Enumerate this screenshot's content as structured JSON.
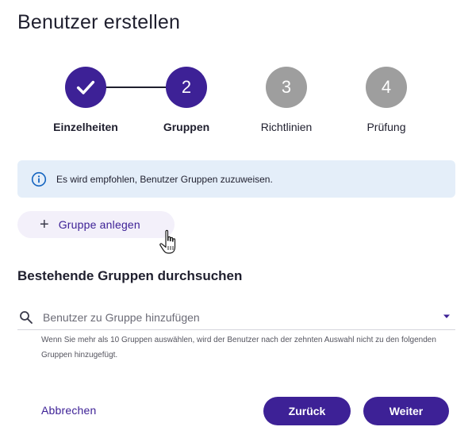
{
  "dialog": {
    "title": "Benutzer erstellen"
  },
  "stepper": {
    "steps": [
      {
        "number": "",
        "label": "Einzelheiten",
        "state": "completed",
        "icon": "check-icon"
      },
      {
        "number": "2",
        "label": "Gruppen",
        "state": "current"
      },
      {
        "number": "3",
        "label": "Richtlinien",
        "state": "upcoming"
      },
      {
        "number": "4",
        "label": "Prüfung",
        "state": "upcoming"
      }
    ]
  },
  "info_banner": {
    "icon": "info-icon",
    "text": "Es wird empfohlen, Benutzer Gruppen zuzuweisen."
  },
  "create_group": {
    "icon": "plus-icon",
    "label": "Gruppe anlegen"
  },
  "search_section": {
    "heading": "Bestehende Gruppen durchsuchen",
    "placeholder": "Benutzer zu Gruppe hinzufügen",
    "value": "",
    "helper_text": "Wenn Sie mehr als 10 Gruppen auswählen, wird der Benutzer nach der zehnten Auswahl nicht zu den folgenden Gruppen hinzugefügt."
  },
  "footer": {
    "cancel_label": "Abbrechen",
    "back_label": "Zurück",
    "next_label": "Weiter"
  },
  "colors": {
    "primary": "#3d2196",
    "inactive_step": "#9e9e9e",
    "info_background": "#e4eef9",
    "info_icon": "#1565c0",
    "secondary_button_background": "#f3f0fa"
  }
}
